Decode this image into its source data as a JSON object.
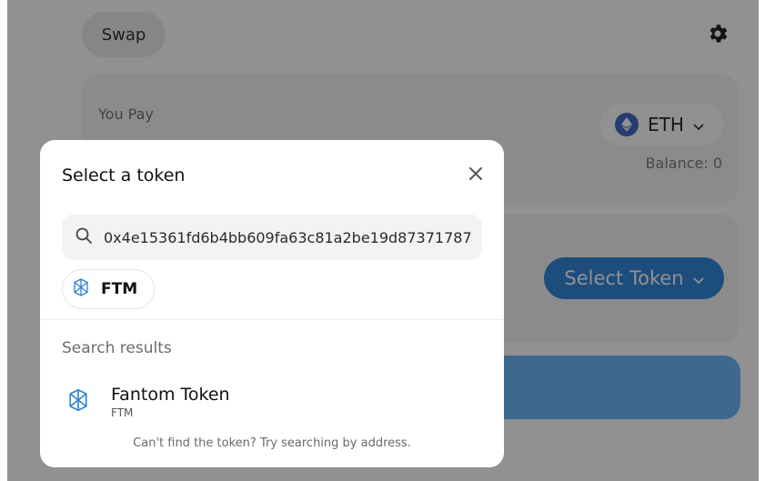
{
  "app": {
    "tab_label": "Swap",
    "pay_label": "You Pay",
    "pay_token": "ETH",
    "balance_text": "Balance: 0",
    "receive_button_label": "Select Token"
  },
  "modal": {
    "title": "Select a token",
    "search_value": "0x4e15361fd6b4bb609fa63c81a2be19d87371787",
    "common_tokens": [
      {
        "symbol": "FTM",
        "icon": "fantom-icon"
      }
    ],
    "results_label": "Search results",
    "results": [
      {
        "name": "Fantom Token",
        "symbol": "FTM",
        "icon": "fantom-icon"
      }
    ],
    "hint": "Can't find the token? Try searching by address."
  },
  "colors": {
    "accent": "#2d84d8",
    "cta": "#69b4f6",
    "eth": "#3b64c4",
    "fantom": "#2f7fd6"
  }
}
